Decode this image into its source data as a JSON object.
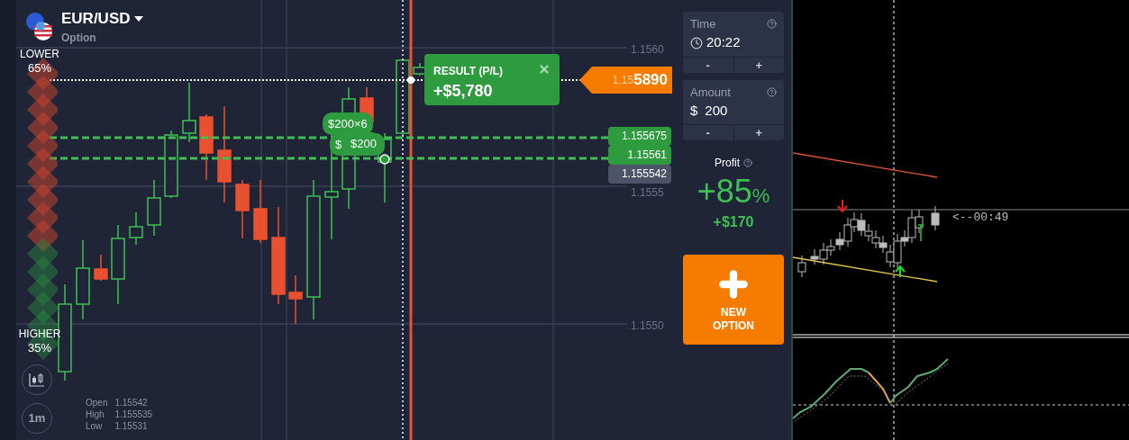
{
  "instrument": {
    "pair": "EUR/USD",
    "type": "Option"
  },
  "sentiment": {
    "lower_label": "LOWER",
    "lower_pct": "65%",
    "higher_label": "HIGHER",
    "higher_pct": "35%"
  },
  "timeframe": "1m",
  "price_axis": [
    "1.1560",
    "1.1555",
    "1.1550"
  ],
  "ohlc": [
    {
      "label": "Open",
      "value": "1.15542"
    },
    {
      "label": "High",
      "value": "1.155535"
    },
    {
      "label": "Low",
      "value": "1.15531"
    }
  ],
  "result": {
    "title": "RESULT (P/L)",
    "value": "+$5,780"
  },
  "current_price": {
    "prefix": "1.15",
    "main": "5890"
  },
  "deal_chips": {
    "count_label": "$200×6",
    "behind": "$",
    "front": "$200"
  },
  "price_tags": [
    {
      "value": "1.155675",
      "kind": "deal"
    },
    {
      "value": "1.15561",
      "kind": "deal"
    },
    {
      "value": "1.155542",
      "kind": "quote"
    }
  ],
  "time": {
    "label": "Time",
    "value": "20:22",
    "minus": "-",
    "plus": "+"
  },
  "amount": {
    "label": "Amount",
    "currency": "$",
    "value": "200",
    "minus": "-",
    "plus": "+"
  },
  "profit": {
    "label": "Profit",
    "percent": "+85",
    "unit": "%",
    "amount": "+$170"
  },
  "new_option": {
    "label": "NEW OPTION"
  },
  "terminal": {
    "countdown": "<--00:49"
  }
}
